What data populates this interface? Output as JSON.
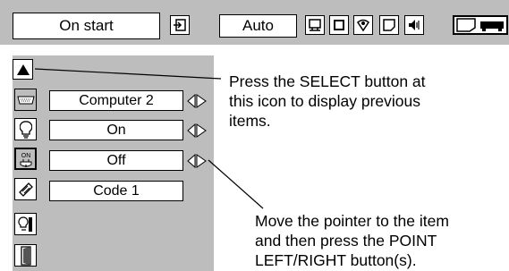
{
  "menu": {
    "title": "On start",
    "source_value": "Auto"
  },
  "rows": [
    {
      "icon": "keyboard-icon",
      "value": "Computer 2",
      "has_arrows": true
    },
    {
      "icon": "lamp-icon",
      "value": "On",
      "has_arrows": true
    },
    {
      "icon": "power-on-icon",
      "value": "Off",
      "has_arrows": true
    },
    {
      "icon": "security-code-icon",
      "value": "Code 1",
      "has_arrows": false
    }
  ],
  "callouts": {
    "select_hint": "Press the SELECT button at\nthis icon to display previous\nitems.",
    "point_hint": "Move the pointer to the item\nand then press the POINT\nLEFT/RIGHT button(s)."
  },
  "icons": {
    "top": [
      "input-icon",
      "screen-size-icon",
      "image-icon",
      "setting-icon",
      "keystone-icon",
      "sound-icon",
      "projector-icon"
    ],
    "side_extra": [
      "lamp-tool-icon",
      "door-icon"
    ],
    "up": "up-triangle-icon",
    "arrows": "left-right-arrows-icon",
    "power_on_label": "ON"
  }
}
